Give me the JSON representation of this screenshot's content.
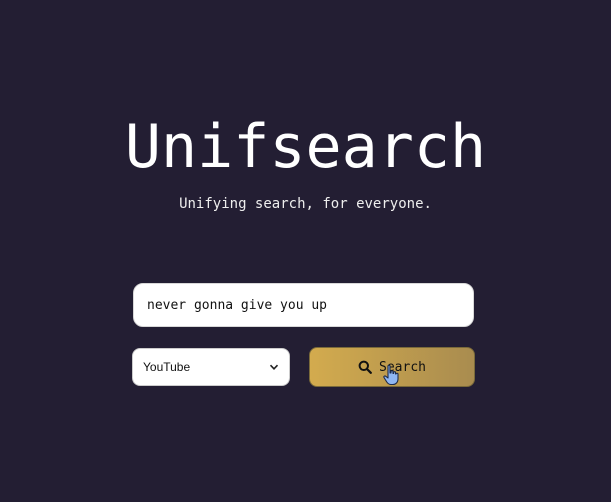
{
  "app": {
    "title": "Unifsearch",
    "tagline": "Unifying search, for everyone."
  },
  "search": {
    "query": "never gonna give you up",
    "placeholder": ""
  },
  "engine": {
    "selected": "YouTube"
  },
  "actions": {
    "search_label": "Search"
  },
  "icons": {
    "search_button": "search-icon",
    "select_arrow": "chevron-down-icon",
    "pointer": "hand-pointer-cursor"
  },
  "colors": {
    "background": "#231e33",
    "button_gradient_start": "#d3ab4e",
    "button_gradient_end": "#a98c4f",
    "text_primary": "#ffffff"
  }
}
